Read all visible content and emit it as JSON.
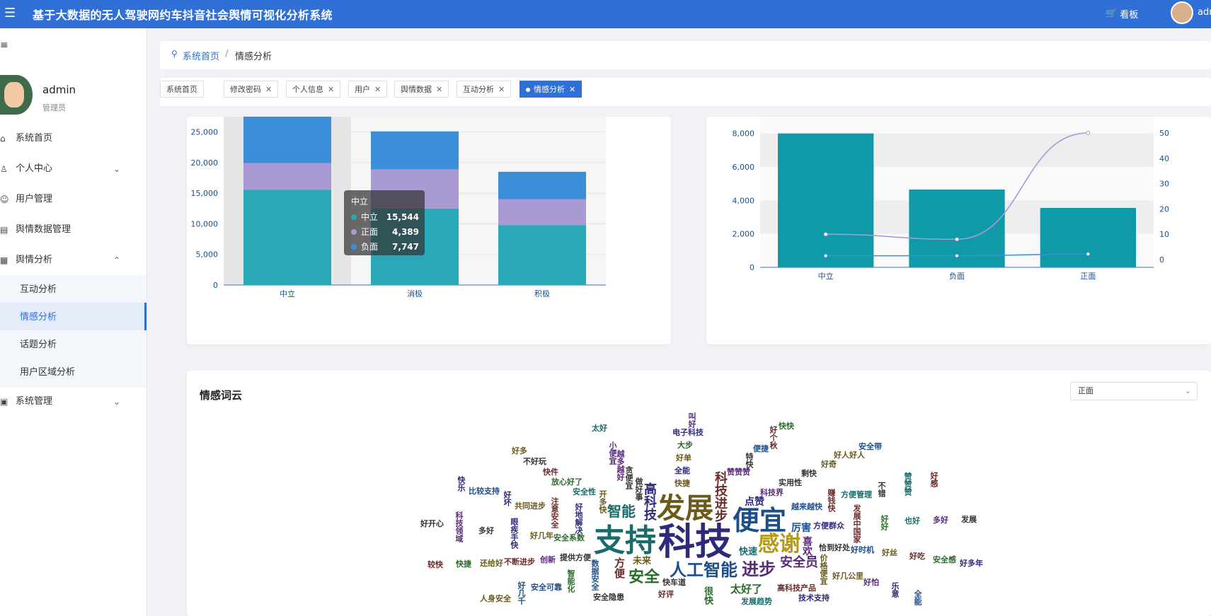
{
  "header": {
    "title": "基于大数据的无人驾驶网约车抖音社会舆情可视化分析系统",
    "kanban_label": "看板",
    "user_label": "adm"
  },
  "sidebar": {
    "user": {
      "name": "admin",
      "role": "管理员"
    },
    "items": [
      {
        "label": "系统首页",
        "icon": "home-icon"
      },
      {
        "label": "个人中心",
        "icon": "user-icon",
        "chevron": "chevron-down-icon"
      },
      {
        "label": "用户管理",
        "icon": "users-icon"
      },
      {
        "label": "舆情数据管理",
        "icon": "data-icon"
      },
      {
        "label": "舆情分析",
        "icon": "chart-icon",
        "chevron": "chevron-up-icon"
      }
    ],
    "sub_items": [
      {
        "label": "互动分析"
      },
      {
        "label": "情感分析",
        "active": true
      },
      {
        "label": "话题分析"
      },
      {
        "label": "用户区域分析"
      }
    ],
    "bottom_item": {
      "label": "系统管理",
      "icon": "settings-icon"
    }
  },
  "breadcrumb": {
    "home": "系统首页",
    "separator": "/",
    "current": "情感分析"
  },
  "tags": [
    {
      "label": "系统首页",
      "closable": false
    },
    {
      "label": "修改密码",
      "closable": true
    },
    {
      "label": "个人信息",
      "closable": true
    },
    {
      "label": "用户",
      "closable": true
    },
    {
      "label": "舆情数据",
      "closable": true
    },
    {
      "label": "互动分析",
      "closable": true
    },
    {
      "label": "情感分析",
      "closable": true,
      "active": true
    }
  ],
  "chart_data": [
    {
      "type": "bar",
      "stacked": true,
      "categories": [
        "中立",
        "消极",
        "积极"
      ],
      "series": [
        {
          "name": "中立",
          "color": "#29a9b8",
          "values": [
            15544,
            12500,
            9800
          ]
        },
        {
          "name": "正面",
          "color": "#a99ad3",
          "values": [
            4389,
            6400,
            4200
          ]
        },
        {
          "name": "负面",
          "color": "#3b8fd8",
          "values": [
            7747,
            6200,
            4500
          ]
        }
      ],
      "ylim": [
        0,
        27500
      ],
      "yticks": [
        "0",
        "5,000",
        "10,000",
        "15,000",
        "20,000",
        "25,000"
      ],
      "tooltip": {
        "title": "中立",
        "rows": [
          {
            "name": "中立",
            "value": "15,544",
            "color": "#29a9b8"
          },
          {
            "name": "正面",
            "value": "4,389",
            "color": "#a99ad3"
          },
          {
            "name": "负面",
            "value": "7,747",
            "color": "#3b8fd8"
          }
        ]
      }
    },
    {
      "type": "bar+line",
      "categories": [
        "中立",
        "负面",
        "正面"
      ],
      "bar_values": [
        8000,
        4650,
        3550
      ],
      "bar_color": "#0e9aa7",
      "ylim": [
        0,
        9000
      ],
      "yticks": [
        "0",
        "2,000",
        "4,000",
        "6,000",
        "8,000"
      ],
      "y2lim": [
        0,
        50
      ],
      "y2ticks": [
        "0",
        "10",
        "20",
        "30",
        "40",
        "50"
      ],
      "lines": [
        {
          "color": "#a99ad3",
          "values": [
            10,
            8,
            50
          ]
        },
        {
          "color": "#3b8fd8",
          "values": [
            1.5,
            1.5,
            2.2
          ]
        }
      ]
    }
  ],
  "wordcloud": {
    "title": "情感词云",
    "select_value": "正面",
    "words": [
      [
        "科技",
        52,
        "#2d2a7a"
      ],
      [
        "支持",
        44,
        "#1a6b6b"
      ],
      [
        "发展",
        40,
        "#6b5a1a"
      ],
      [
        "便宜",
        38,
        "#1c4f8a"
      ],
      [
        "人工智能",
        24,
        "#1c4f8a"
      ],
      [
        "感谢",
        30,
        "#b59a1a"
      ],
      [
        "进步",
        24,
        "#5a2a7a"
      ],
      [
        "科技进步",
        18,
        "#6b2a2a"
      ],
      [
        "安全",
        22,
        "#2a6b2a"
      ],
      [
        "智能",
        20,
        "#1a6b6b"
      ],
      [
        "高科技",
        18,
        "#2d2a7a"
      ],
      [
        "安全员",
        18,
        "#5a2a7a"
      ],
      [
        "太好了",
        15,
        "#2a6b2a"
      ],
      [
        "方便",
        15,
        "#6b2a2a"
      ],
      [
        "快速",
        13,
        "#1a6b6b"
      ],
      [
        "点赞",
        14,
        "#2d2a7a"
      ],
      [
        "喜欢",
        14,
        "#5a2a7a"
      ],
      [
        "厉害",
        14,
        "#1c4f8a"
      ],
      [
        "未来",
        13,
        "#6b5a1a"
      ],
      [
        "很快",
        13,
        "#2a6b2a"
      ],
      [
        "快车道",
        11,
        "#333333"
      ],
      [
        "好评",
        11,
        "#6b2a2a"
      ],
      [
        "数据安全",
        11,
        "#1c4f8a"
      ],
      [
        "提供方便",
        11,
        "#333333"
      ],
      [
        "安全系数",
        11,
        "#2a6b2a"
      ],
      [
        "好地解决",
        11,
        "#2d2a7a"
      ],
      [
        "快捷",
        11,
        "#6b5a1a"
      ],
      [
        "科技界",
        11,
        "#5a2a7a"
      ],
      [
        "开多快",
        11,
        "#6b5a1a"
      ],
      [
        "越来越快",
        11,
        "#1c4f8a"
      ],
      [
        "方便群众",
        11,
        "#2d2a7a"
      ],
      [
        "做好事",
        11,
        "#333333"
      ],
      [
        "恰到好处",
        11,
        "#333333"
      ],
      [
        "高科技产品",
        11,
        "#6b2a2a"
      ],
      [
        "价格便宜",
        11,
        "#6b5a1a"
      ],
      [
        "发展趋势",
        11,
        "#1a6b6b"
      ],
      [
        "安全隐患",
        11,
        "#333333"
      ],
      [
        "智能化",
        11,
        "#2a6b2a"
      ],
      [
        "创新",
        11,
        "#5a2a7a"
      ],
      [
        "好几年",
        11,
        "#6b5a1a"
      ],
      [
        "注意安全",
        11,
        "#6b2a2a"
      ],
      [
        "安全性",
        11,
        "#1a6b6b"
      ],
      [
        "全能",
        11,
        "#2d2a7a"
      ],
      [
        "贪便宜",
        11,
        "#333333"
      ],
      [
        "赞赞赞",
        11,
        "#5a2a7a"
      ],
      [
        "实用性",
        11,
        "#333333"
      ],
      [
        "赚钱快",
        11,
        "#6b2a2a"
      ],
      [
        "好几公里",
        11,
        "#6b5a1a"
      ],
      [
        "技术支持",
        11,
        "#2d2a7a"
      ],
      [
        "发展中国家",
        11,
        "#6b2a2a"
      ],
      [
        "安全可靠",
        11,
        "#1c4f8a"
      ],
      [
        "不断进步",
        11,
        "#6b2a2a"
      ],
      [
        "眼疾手快",
        11,
        "#2d2a7a"
      ],
      [
        "共同进步",
        11,
        "#6b5a1a"
      ],
      [
        "放心好了",
        11,
        "#2a6b2a"
      ],
      [
        "越多越好",
        11,
        "#5a2a7a"
      ],
      [
        "好时机",
        11,
        "#1c4f8a"
      ],
      [
        "好单",
        11,
        "#6b5a1a"
      ],
      [
        "特快",
        11,
        "#333333"
      ],
      [
        "剩快",
        11,
        "#333333"
      ],
      [
        "方便管理",
        11,
        "#1a6b6b"
      ],
      [
        "好好",
        11,
        "#2a6b2a"
      ],
      [
        "好丝",
        11,
        "#6b5a1a"
      ],
      [
        "好怕",
        11,
        "#5a2a7a"
      ],
      [
        "好几千",
        11,
        "#1c4f8a"
      ],
      [
        "还给好",
        11,
        "#6b5a1a"
      ],
      [
        "多好",
        11,
        "#333333"
      ],
      [
        "好坏",
        11,
        "#2d2a7a"
      ],
      [
        "快件",
        11,
        "#6b2a2a"
      ],
      [
        "大步",
        11,
        "#2a6b2a"
      ],
      [
        "小便宜",
        11,
        "#5a2a7a"
      ],
      [
        "便捷",
        11,
        "#1c4f8a"
      ],
      [
        "好奇",
        11,
        "#6b5a1a"
      ],
      [
        "不错",
        11,
        "#333333"
      ],
      [
        "也好",
        11,
        "#1a6b6b"
      ],
      [
        "好吃",
        11,
        "#6b2a2a"
      ],
      [
        "乐意",
        11,
        "#2d2a7a"
      ],
      [
        "人身安全",
        11,
        "#6b5a1a"
      ],
      [
        "快捷",
        11,
        "#2a6b2a"
      ],
      [
        "科技领域",
        11,
        "#5a2a7a"
      ],
      [
        "比较支持",
        11,
        "#1c4f8a"
      ],
      [
        "不好玩",
        11,
        "#333333"
      ],
      [
        "好个秋",
        11,
        "#6b2a2a"
      ],
      [
        "电子科技",
        11,
        "#2d2a7a"
      ],
      [
        "好人好人",
        11,
        "#6b5a1a"
      ],
      [
        "赞赞赞",
        11,
        "#1a6b6b"
      ],
      [
        "多好",
        11,
        "#5a2a7a"
      ],
      [
        "安全感",
        11,
        "#2a6b2a"
      ],
      [
        "全能",
        11,
        "#1c4f8a"
      ],
      [
        "较快",
        11,
        "#6b2a2a"
      ],
      [
        "好开心",
        11,
        "#333333"
      ],
      [
        "快乐",
        11,
        "#2d2a7a"
      ],
      [
        "好多",
        11,
        "#6b5a1a"
      ],
      [
        "太好",
        11,
        "#1a6b6b"
      ],
      [
        "叫好",
        11,
        "#5a2a7a"
      ],
      [
        "快快",
        11,
        "#2a6b2a"
      ],
      [
        "安全带",
        11,
        "#1c4f8a"
      ],
      [
        "好感",
        11,
        "#6b2a2a"
      ],
      [
        "发展",
        11,
        "#333333"
      ],
      [
        "好多年",
        11,
        "#2d2a7a"
      ]
    ]
  }
}
